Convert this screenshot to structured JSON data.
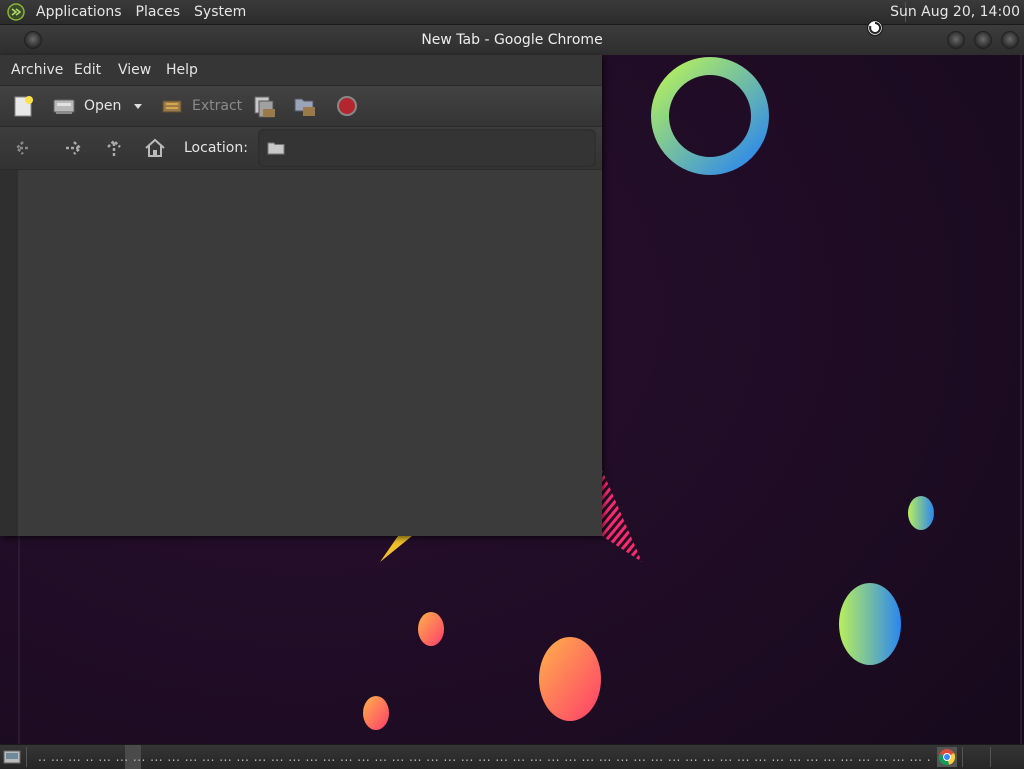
{
  "top_panel": {
    "menus": [
      "Applications",
      "Places",
      "System"
    ],
    "clock": "Sun Aug 20, 14:00"
  },
  "chrome": {
    "title": "New Tab - Google Chrome"
  },
  "archive_manager": {
    "menus": [
      "Archive",
      "Edit",
      "View",
      "Help"
    ],
    "toolbar": {
      "open_label": "Open",
      "extract_label": "Extract"
    },
    "location_label": "Location:",
    "icons": {
      "new": "new-archive-icon",
      "open": "open-icon",
      "dropdown": "chevron-down-icon",
      "extract": "extract-icon",
      "add_files": "add-files-icon",
      "add_folder": "add-folder-icon",
      "stop": "stop-icon",
      "back": "back-arrow-icon",
      "forward": "forward-arrow-icon",
      "up": "up-arrow-icon",
      "home": "home-icon",
      "folder": "folder-icon"
    }
  },
  "bottom_panel": {
    "taskbar_text": ".. ... ... .. ... ... ... ... ... ... ... ... ... ... ... ... ... ... ... ... ... ... ... ... ... ... ... ... ... ... ... ... ... ... ... ... ... ... ... ... ... ... ... ... ... ... ... ... ... ... ... ... ... ... ... ... ... ... ... ... ... ... ... ... ... ... ... ... ... ... ... ... ... ... ... ... ... ..."
  },
  "colors": {
    "wallpaper": "#1e0d22",
    "panel": "#2e2e2e",
    "window": "#3b3b3b",
    "stop_red": "#b3262d"
  }
}
